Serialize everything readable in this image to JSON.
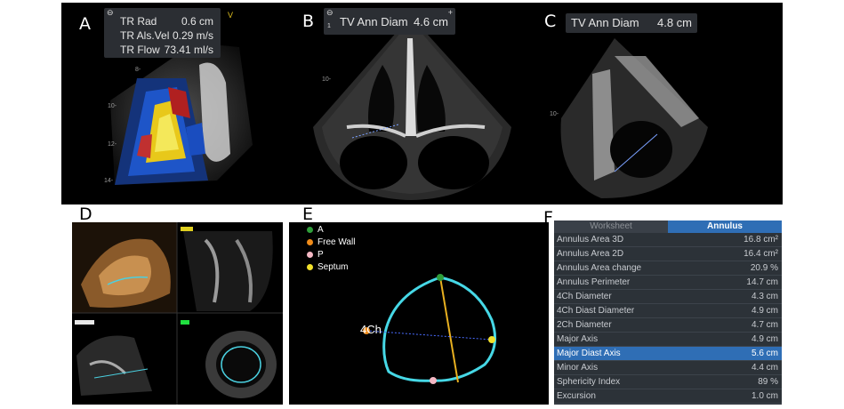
{
  "labels": {
    "a": "A",
    "b": "B",
    "c": "C",
    "d": "D",
    "e": "E",
    "f": "F"
  },
  "panel_a": {
    "rows": [
      {
        "name": "TR Rad",
        "value": "0.6 cm"
      },
      {
        "name": "TR Als.Vel",
        "value": "0.29 m/s"
      },
      {
        "name": "TR Flow",
        "value": "73.41 ml/s"
      }
    ],
    "marker": "V",
    "depth_ticks": [
      "8-",
      "10-",
      "12-",
      "14-"
    ]
  },
  "panel_b": {
    "name": "TV Ann Diam",
    "value": "4.6 cm",
    "row_index": "1",
    "depth_tick": "10-"
  },
  "panel_c": {
    "name": "TV Ann Diam",
    "value": "4.8 cm",
    "depth_tick": "10-"
  },
  "panel_e": {
    "legend": [
      {
        "label": "A",
        "color": "#2f9e3a"
      },
      {
        "label": "Free Wall",
        "color": "#f08c1a"
      },
      {
        "label": "P",
        "color": "#f4b8c4"
      },
      {
        "label": "Septum",
        "color": "#f2e12b"
      }
    ],
    "view_label": "4Ch"
  },
  "panel_f": {
    "tabs": [
      {
        "label": "Worksheet",
        "active": false
      },
      {
        "label": "Annulus",
        "active": true
      }
    ],
    "rows": [
      {
        "name": "Annulus Area 3D",
        "value": "16.8 cm²"
      },
      {
        "name": "Annulus Area 2D",
        "value": "16.4 cm²"
      },
      {
        "name": "Annulus Area change",
        "value": "20.9 %"
      },
      {
        "name": "Annulus Perimeter",
        "value": "14.7 cm"
      },
      {
        "name": "4Ch Diameter",
        "value": "4.3 cm"
      },
      {
        "name": "4Ch Diast Diameter",
        "value": "4.9 cm"
      },
      {
        "name": "2Ch Diameter",
        "value": "4.7 cm"
      },
      {
        "name": "Major Axis",
        "value": "4.9 cm"
      },
      {
        "name": "Major Diast Axis",
        "value": "5.6 cm",
        "selected": true
      },
      {
        "name": "Minor Axis",
        "value": "4.4 cm"
      },
      {
        "name": "Sphericity Index",
        "value": "89 %"
      },
      {
        "name": "Excursion",
        "value": "1.0 cm"
      }
    ]
  }
}
